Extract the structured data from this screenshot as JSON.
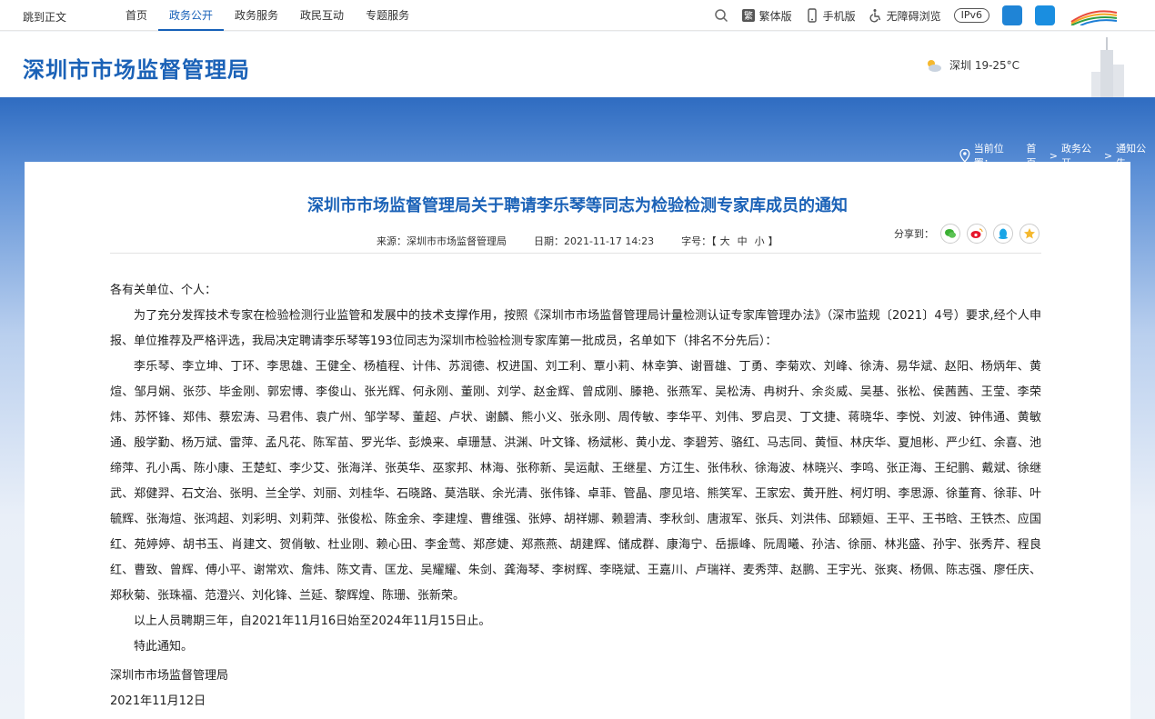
{
  "topbar": {
    "skip_label": "跳到正文",
    "nav": [
      "首页",
      "政务公开",
      "政务服务",
      "政民互动",
      "专题服务"
    ],
    "active_nav": "政务公开",
    "tools": {
      "traditional": "繁体版",
      "mobile": "手机版",
      "accessible": "无障碍浏览",
      "ipv6": "IPv6"
    }
  },
  "header": {
    "site_title": "深圳市市场监督管理局",
    "weather": "深圳 19-25°C"
  },
  "breadcrumb": {
    "prefix": "当前位置：",
    "items": [
      "首页",
      "政务公开",
      "通知公告"
    ],
    "separator": ">"
  },
  "article": {
    "title": "深圳市市场监督管理局关于聘请李乐琴等同志为检验检测专家库成员的通知",
    "source_label": "来源：",
    "source": "深圳市市场监督管理局",
    "date_label": "日期：",
    "date": "2021-11-17 14:23",
    "font_label": "字号：",
    "font_open": "【",
    "font_large": "大",
    "font_medium": "中",
    "font_small": "小",
    "font_close": "】",
    "share_label": "分享到：",
    "salutation": "各有关单位、个人：",
    "para1": "为了充分发挥技术专家在检验检测行业监管和发展中的技术支撑作用，按照《深圳市市场监督管理局计量检测认证专家库管理办法》（深市监规〔2021〕4号）要求,经个人申报、单位推荐及严格评选，我局决定聘请李乐琴等193位同志为深圳市检验检测专家库第一批成员，名单如下（排名不分先后）：",
    "names": "李乐琴、李立坤、丁环、李思雄、王健全、杨植程、计伟、苏润德、权进国、刘工利、覃小莉、林幸笋、谢晋雄、丁勇、李菊欢、刘峰、徐涛、易华斌、赵阳、杨炳年、黄煊、邹月娴、张莎、毕金刚、郭宏博、李俊山、张光辉、何永刚、董刚、刘学、赵金辉、曾成刚、滕艳、张燕军、吴松涛、冉树升、余炎威、吴基、张松、侯茜茜、王莹、李荣炜、苏怀锋、郑伟、蔡宏涛、马君伟、袁广州、邹学琴、董超、卢状、谢麟、熊小义、张永刚、周传敏、李华平、刘伟、罗启灵、丁文捷、蒋晓华、李悦、刘波、钟伟通、黄敏通、殷学勤、杨万斌、雷萍、孟凡花、陈军苗、罗光华、彭焕来、卓珊慧、洪渊、叶文锋、杨斌彬、黄小龙、李碧芳、骆红、马志同、黄恒、林庆华、夏旭彬、严少红、余喜、池缔萍、孔小禹、陈小康、王楚虹、李少艾、张海洋、张英华、巫家邦、林海、张称新、吴运献、王继星、方江生、张伟秋、徐海波、林晓兴、李鸣、张正海、王纪鹏、戴斌、徐继武、郑健羿、石文治、张明、兰全学、刘丽、刘桂华、石晓路、莫浩联、余光清、张伟锋、卓菲、管晶、廖见培、熊笑军、王家宏、黄开胜、柯灯明、李思源、徐董育、徐菲、叶毓辉、张海煊、张鸿超、刘彩明、刘莉萍、张俊松、陈金余、李建煌、曹维强、张婷、胡祥娜、赖碧清、李秋剑、唐淑军、张兵、刘洪伟、邱颖姮、王平、王书晗、王铁杰、应国红、苑婷婷、胡书玉、肖建文、贺俏敏、杜业刚、赖心田、李金莺、郑彦婕、郑燕燕、胡建辉、储成群、康海宁、岳振峰、阮周曦、孙洁、徐丽、林兆盛、孙宇、张秀芹、程良红、曹致、曾辉、傅小平、谢常欢、詹炜、陈文青、匡龙、吴耀耀、朱剑、龚海琴、李树辉、李晓斌、王嘉川、卢瑞祥、麦秀萍、赵鹏、王宇光、张爽、杨佩、陈志强、廖任庆、郑秋菊、张珠福、范澄兴、刘化锋、兰延、黎辉煌、陈珊、张新荣。",
    "para2": "以上人员聘期三年，自2021年11月16日始至2024年11月15日止。",
    "para3": "特此通知。",
    "sign_org": "深圳市市场监督管理局",
    "sign_date": "2021年11月12日"
  },
  "colors": {
    "brand_blue": "#1b62b7",
    "band_blue": "#2f6cc1"
  }
}
